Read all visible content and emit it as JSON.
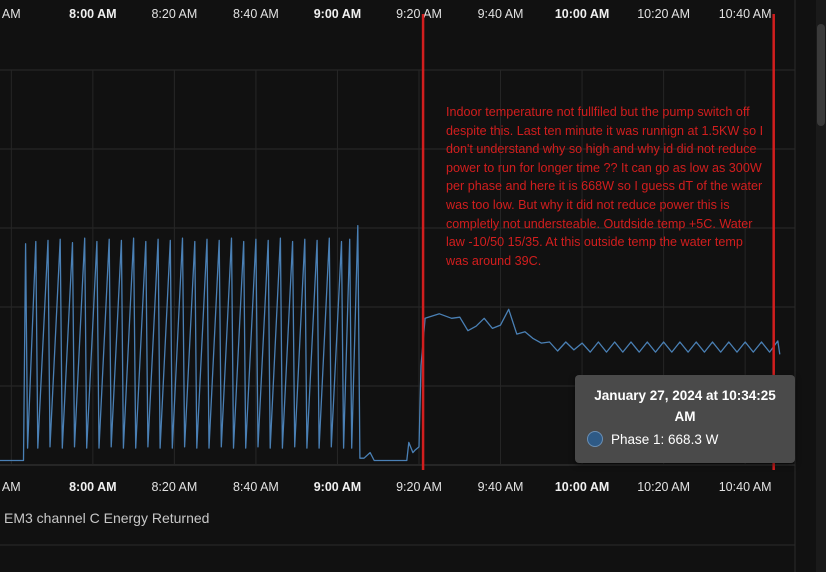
{
  "chart_data": {
    "type": "line",
    "x_ticks": [
      {
        "label": "AM",
        "minutes": 460
      },
      {
        "label": "8:00 AM",
        "minutes": 480,
        "bold": true
      },
      {
        "label": "8:20 AM",
        "minutes": 500
      },
      {
        "label": "8:40 AM",
        "minutes": 520
      },
      {
        "label": "9:00 AM",
        "minutes": 540,
        "bold": true
      },
      {
        "label": "9:20 AM",
        "minutes": 560
      },
      {
        "label": "9:40 AM",
        "minutes": 580
      },
      {
        "label": "10:00 AM",
        "minutes": 600,
        "bold": true
      },
      {
        "label": "10:20 AM",
        "minutes": 620
      },
      {
        "label": "10:40 AM",
        "minutes": 640
      }
    ],
    "x_range_minutes": [
      456,
      651
    ],
    "y_range": [
      0,
      3500
    ],
    "gridlines": true,
    "series": [
      {
        "name": "Phase 1",
        "color": "#4a80b5",
        "points": [
          [
            456,
            40
          ],
          [
            463,
            40
          ],
          [
            463.5,
            1960
          ],
          [
            464,
            150
          ],
          [
            466,
            1980
          ],
          [
            466.5,
            150
          ],
          [
            469,
            1990
          ],
          [
            469.5,
            160
          ],
          [
            472,
            2000
          ],
          [
            472.5,
            150
          ],
          [
            475,
            1970
          ],
          [
            475.5,
            160
          ],
          [
            478,
            2010
          ],
          [
            478.5,
            150
          ],
          [
            481,
            1980
          ],
          [
            481.5,
            150
          ],
          [
            484,
            2000
          ],
          [
            484.5,
            160
          ],
          [
            487,
            1990
          ],
          [
            487.5,
            150
          ],
          [
            490,
            2010
          ],
          [
            490.5,
            150
          ],
          [
            493,
            1980
          ],
          [
            493.5,
            160
          ],
          [
            496,
            2000
          ],
          [
            496.5,
            150
          ],
          [
            499,
            1990
          ],
          [
            499.5,
            150
          ],
          [
            502,
            2010
          ],
          [
            502.5,
            160
          ],
          [
            505,
            1980
          ],
          [
            505.5,
            150
          ],
          [
            508,
            2000
          ],
          [
            508.5,
            150
          ],
          [
            511,
            1990
          ],
          [
            511.5,
            160
          ],
          [
            514,
            2010
          ],
          [
            514.5,
            150
          ],
          [
            517,
            1980
          ],
          [
            517.5,
            150
          ],
          [
            520,
            2000
          ],
          [
            520.5,
            160
          ],
          [
            523,
            1990
          ],
          [
            523.5,
            150
          ],
          [
            526,
            2010
          ],
          [
            526.5,
            150
          ],
          [
            529,
            1980
          ],
          [
            529.5,
            160
          ],
          [
            532,
            2000
          ],
          [
            532.5,
            150
          ],
          [
            535,
            1990
          ],
          [
            535.5,
            150
          ],
          [
            538,
            2010
          ],
          [
            538.5,
            160
          ],
          [
            541,
            1980
          ],
          [
            541.5,
            150
          ],
          [
            543,
            2000
          ],
          [
            543.5,
            150
          ],
          [
            545,
            2120
          ],
          [
            545.5,
            60
          ],
          [
            546.5,
            60
          ],
          [
            548,
            110
          ],
          [
            549,
            40
          ],
          [
            557,
            40
          ],
          [
            557.5,
            200
          ],
          [
            558.5,
            110
          ],
          [
            559,
            130
          ],
          [
            560,
            160
          ],
          [
            560.5,
            880
          ],
          [
            561.5,
            1300
          ],
          [
            565,
            1340
          ],
          [
            568,
            1300
          ],
          [
            570,
            1310
          ],
          [
            572,
            1190
          ],
          [
            574,
            1230
          ],
          [
            576,
            1300
          ],
          [
            578,
            1210
          ],
          [
            580,
            1240
          ],
          [
            582,
            1380
          ],
          [
            584,
            1160
          ],
          [
            586,
            1180
          ],
          [
            588,
            1120
          ],
          [
            590,
            1080
          ],
          [
            592,
            1090
          ],
          [
            594,
            1010
          ],
          [
            596,
            1090
          ],
          [
            598,
            1020
          ],
          [
            600,
            1080
          ],
          [
            602,
            1000
          ],
          [
            604,
            1090
          ],
          [
            606,
            1000
          ],
          [
            608,
            1090
          ],
          [
            610,
            1000
          ],
          [
            612,
            1090
          ],
          [
            614,
            1000
          ],
          [
            616,
            1090
          ],
          [
            618,
            1000
          ],
          [
            620,
            1090
          ],
          [
            622,
            1000
          ],
          [
            624,
            1090
          ],
          [
            626,
            1000
          ],
          [
            628,
            1090
          ],
          [
            630,
            1000
          ],
          [
            632,
            1090
          ],
          [
            634,
            1000
          ],
          [
            636,
            1090
          ],
          [
            638,
            1000
          ],
          [
            640,
            1090
          ],
          [
            642,
            1000
          ],
          [
            644,
            1090
          ],
          [
            646,
            1000
          ],
          [
            648,
            1100
          ],
          [
            648.5,
            980
          ]
        ]
      }
    ]
  },
  "annotation": {
    "text": "Indoor temperature not fullfiled but the pump switch off despite this. Last ten minute it was runnign at 1.5KW so I don't understand why so high and why id did not reduce power to run for longer time ?? It can go as low as 300W per phase and here it is 668W so I guess dT of the water was too low. But why it did not reduce power this is completly not understeable. Outdside temp +5C. Water law -10/50 15/35. At this outside temp the water temp was around 39C.",
    "color": "#d21e1e",
    "marker_lines_minutes": [
      561,
      647
    ]
  },
  "tooltip": {
    "title": "January 27, 2024 at 10:34:25 AM",
    "series_label": "Phase 1: 668.3 W"
  },
  "legend": {
    "label": "EM3 channel C Energy Returned"
  }
}
